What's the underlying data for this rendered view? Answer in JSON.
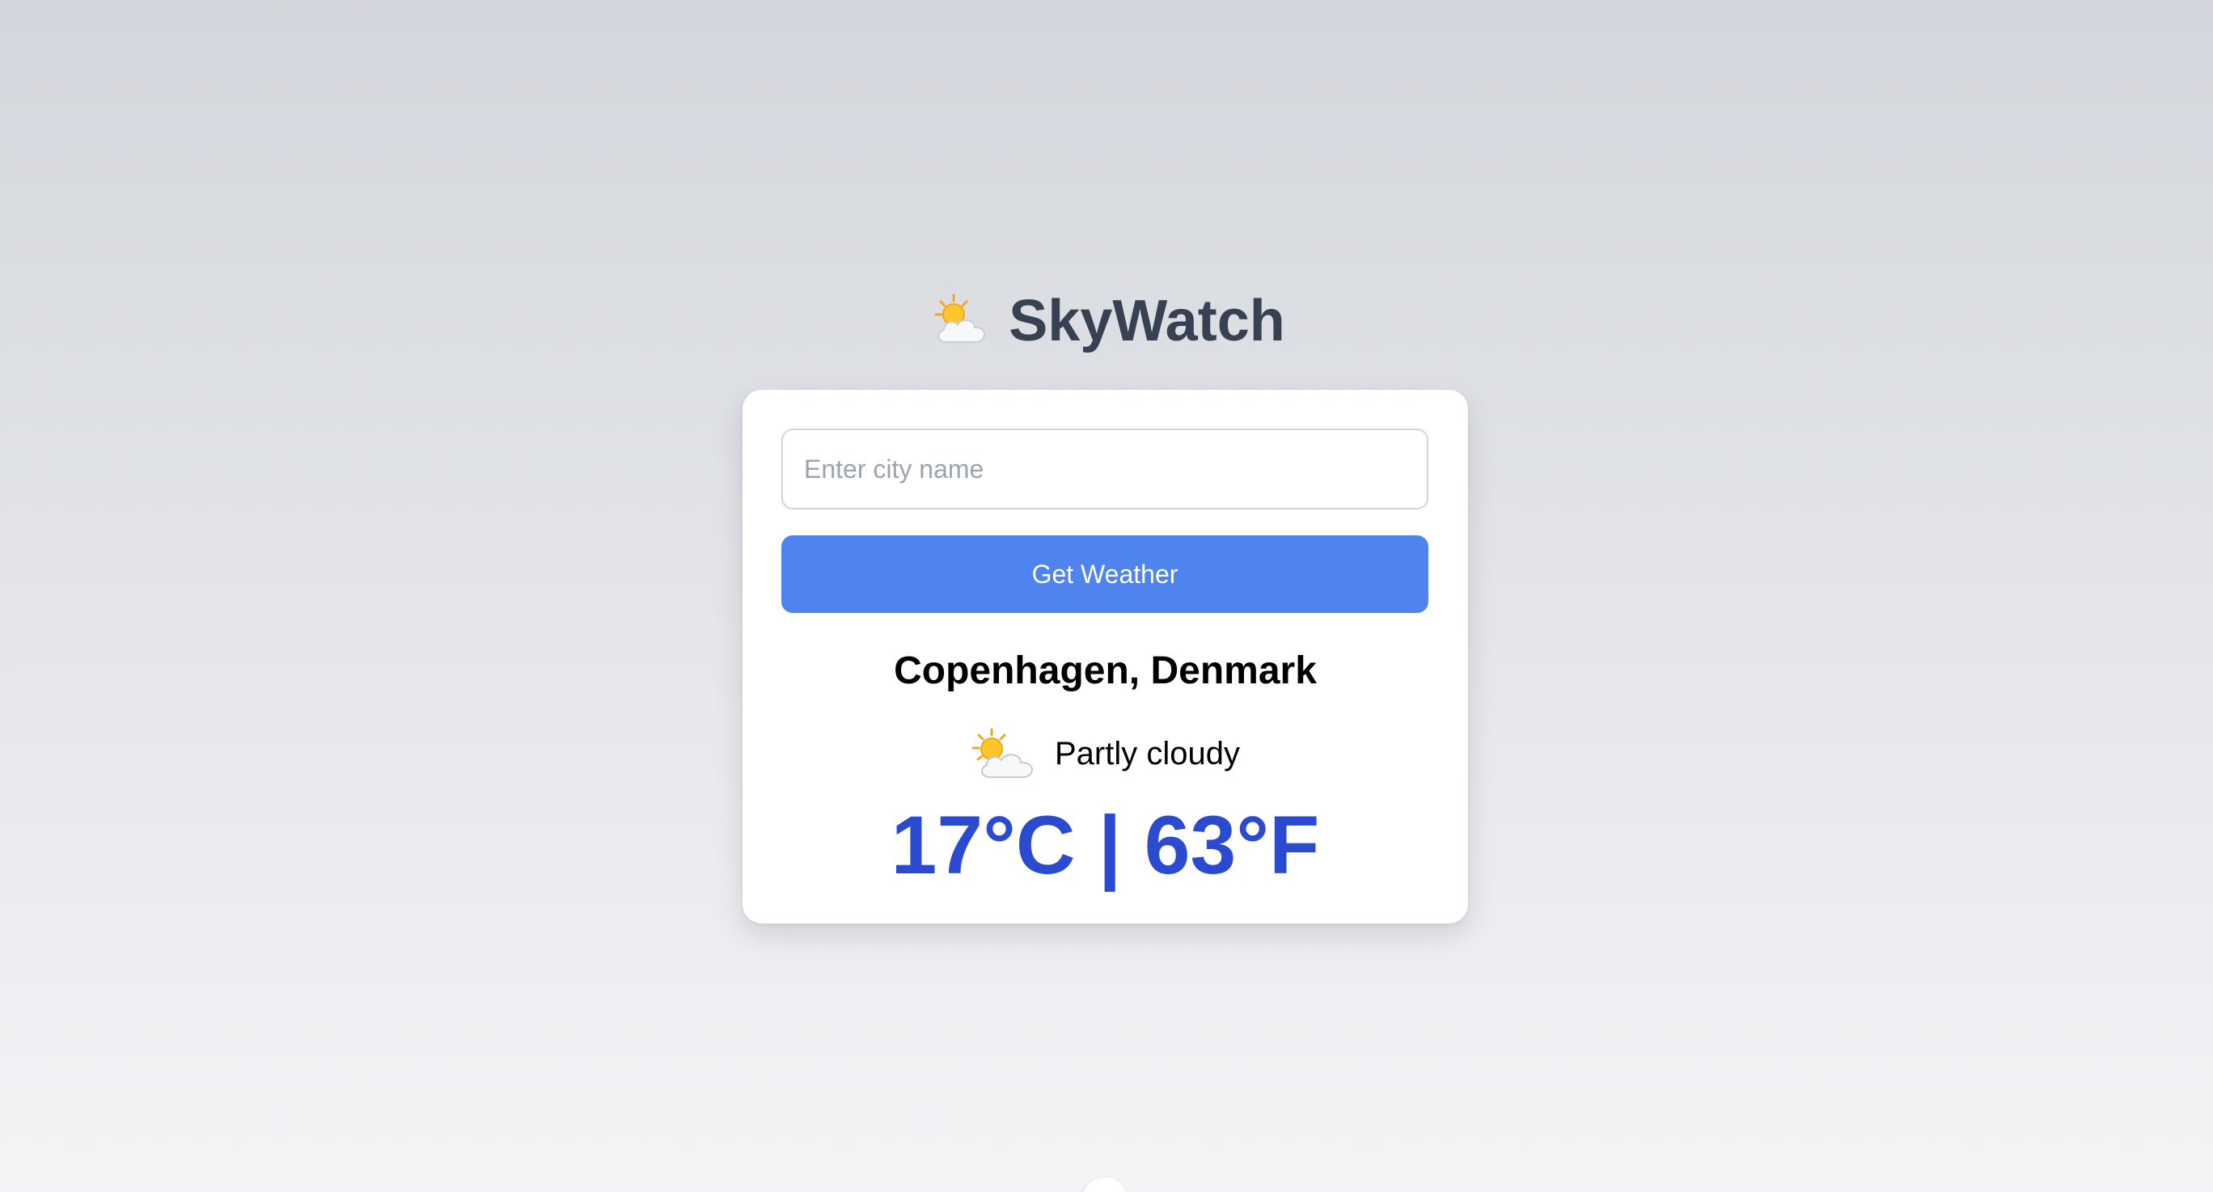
{
  "header": {
    "logo_icon": "sun-behind-cloud-icon",
    "title": "SkyWatch"
  },
  "search": {
    "placeholder": "Enter city name",
    "value": "",
    "button_label": "Get Weather"
  },
  "weather": {
    "location": "Copenhagen, Denmark",
    "condition_icon": "sun-behind-cloud-icon",
    "condition": "Partly cloudy",
    "temperature_display": "17°C | 63°F"
  },
  "colors": {
    "accent_button": "#4f83ee",
    "temperature": "#2a4bcf",
    "title": "#374151"
  }
}
